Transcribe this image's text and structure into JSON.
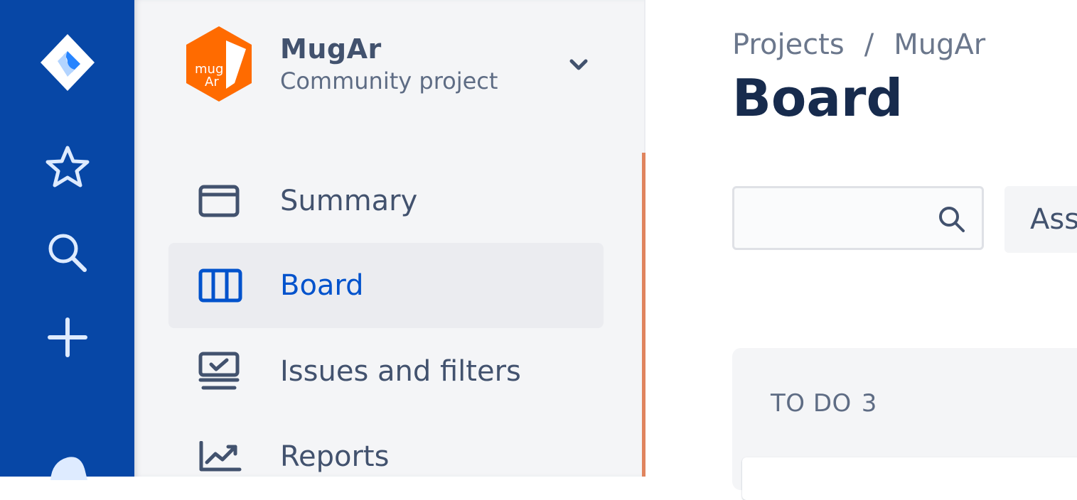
{
  "global_nav": {
    "items": [
      {
        "icon": "jira-logo-icon"
      },
      {
        "icon": "star-icon"
      },
      {
        "icon": "search-icon"
      },
      {
        "icon": "plus-icon"
      },
      {
        "icon": "notifications-icon"
      }
    ]
  },
  "project": {
    "name": "MugAr",
    "type": "Community project",
    "avatar_text_top": "mug",
    "avatar_text_bottom": "Ar",
    "avatar_color": "#ff6b00"
  },
  "sidebar": {
    "items": [
      {
        "label": "Summary",
        "icon": "summary-icon",
        "selected": false
      },
      {
        "label": "Board",
        "icon": "board-icon",
        "selected": true
      },
      {
        "label": "Issues and filters",
        "icon": "issues-icon",
        "selected": false
      },
      {
        "label": "Reports",
        "icon": "reports-icon",
        "selected": false
      }
    ]
  },
  "breadcrumb": {
    "root": "Projects",
    "separator": "/",
    "current": "MugAr"
  },
  "page": {
    "title": "Board"
  },
  "search": {
    "value": "",
    "placeholder": ""
  },
  "filters": {
    "assignee_label": "Ass"
  },
  "board": {
    "columns": [
      {
        "title": "TO DO",
        "count": "3"
      }
    ]
  },
  "colors": {
    "global_nav_bg": "#0747a6",
    "sidebar_bg": "#f4f5f7",
    "selected_text": "#0052cc",
    "title_text": "#172b4d"
  }
}
